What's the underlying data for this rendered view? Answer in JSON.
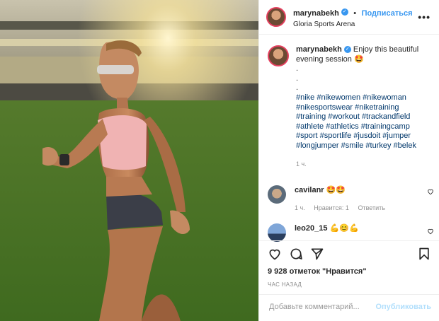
{
  "header": {
    "username": "marynabekh",
    "separator": "•",
    "follow_label": "Подписаться",
    "location": "Gloria Sports Arena"
  },
  "caption": {
    "username": "marynabekh",
    "text": "Enjoy this beautiful evening session",
    "emoji": "🤩",
    "dots": ".\n.\n.",
    "hashtags": "#nike #nikewomen #nikewoman\n#nikesportswear #niketraining\n#training #workout #trackandfield\n#athlete #athletics #trainingcamp\n#sport #sportlife #jusdoit #jumper\n#longjumper #smile #turkey #belek",
    "time": "1 ч."
  },
  "comments": [
    {
      "username": "cavilanr",
      "text": "🤩🤩",
      "time": "1 ч.",
      "likes": "Нравится: 1",
      "reply": "Ответить"
    },
    {
      "username": "leo20_15",
      "text": "💪😊💪"
    }
  ],
  "likes_text": "9 928 отметок \"Нравится\"",
  "posted_ago": "ЧАС НАЗАД",
  "add_comment": {
    "placeholder": "Добавьте комментарий...",
    "publish_label": "Опубликовать"
  },
  "icons": [
    "more-icon",
    "verified-icon",
    "heart-icon",
    "comment-icon",
    "share-icon",
    "bookmark-icon"
  ],
  "colors": {
    "accent": "#3897f0",
    "publish_disabled": "#b2dffc",
    "hashtag": "#00376b",
    "muted": "#8e8e8e"
  }
}
